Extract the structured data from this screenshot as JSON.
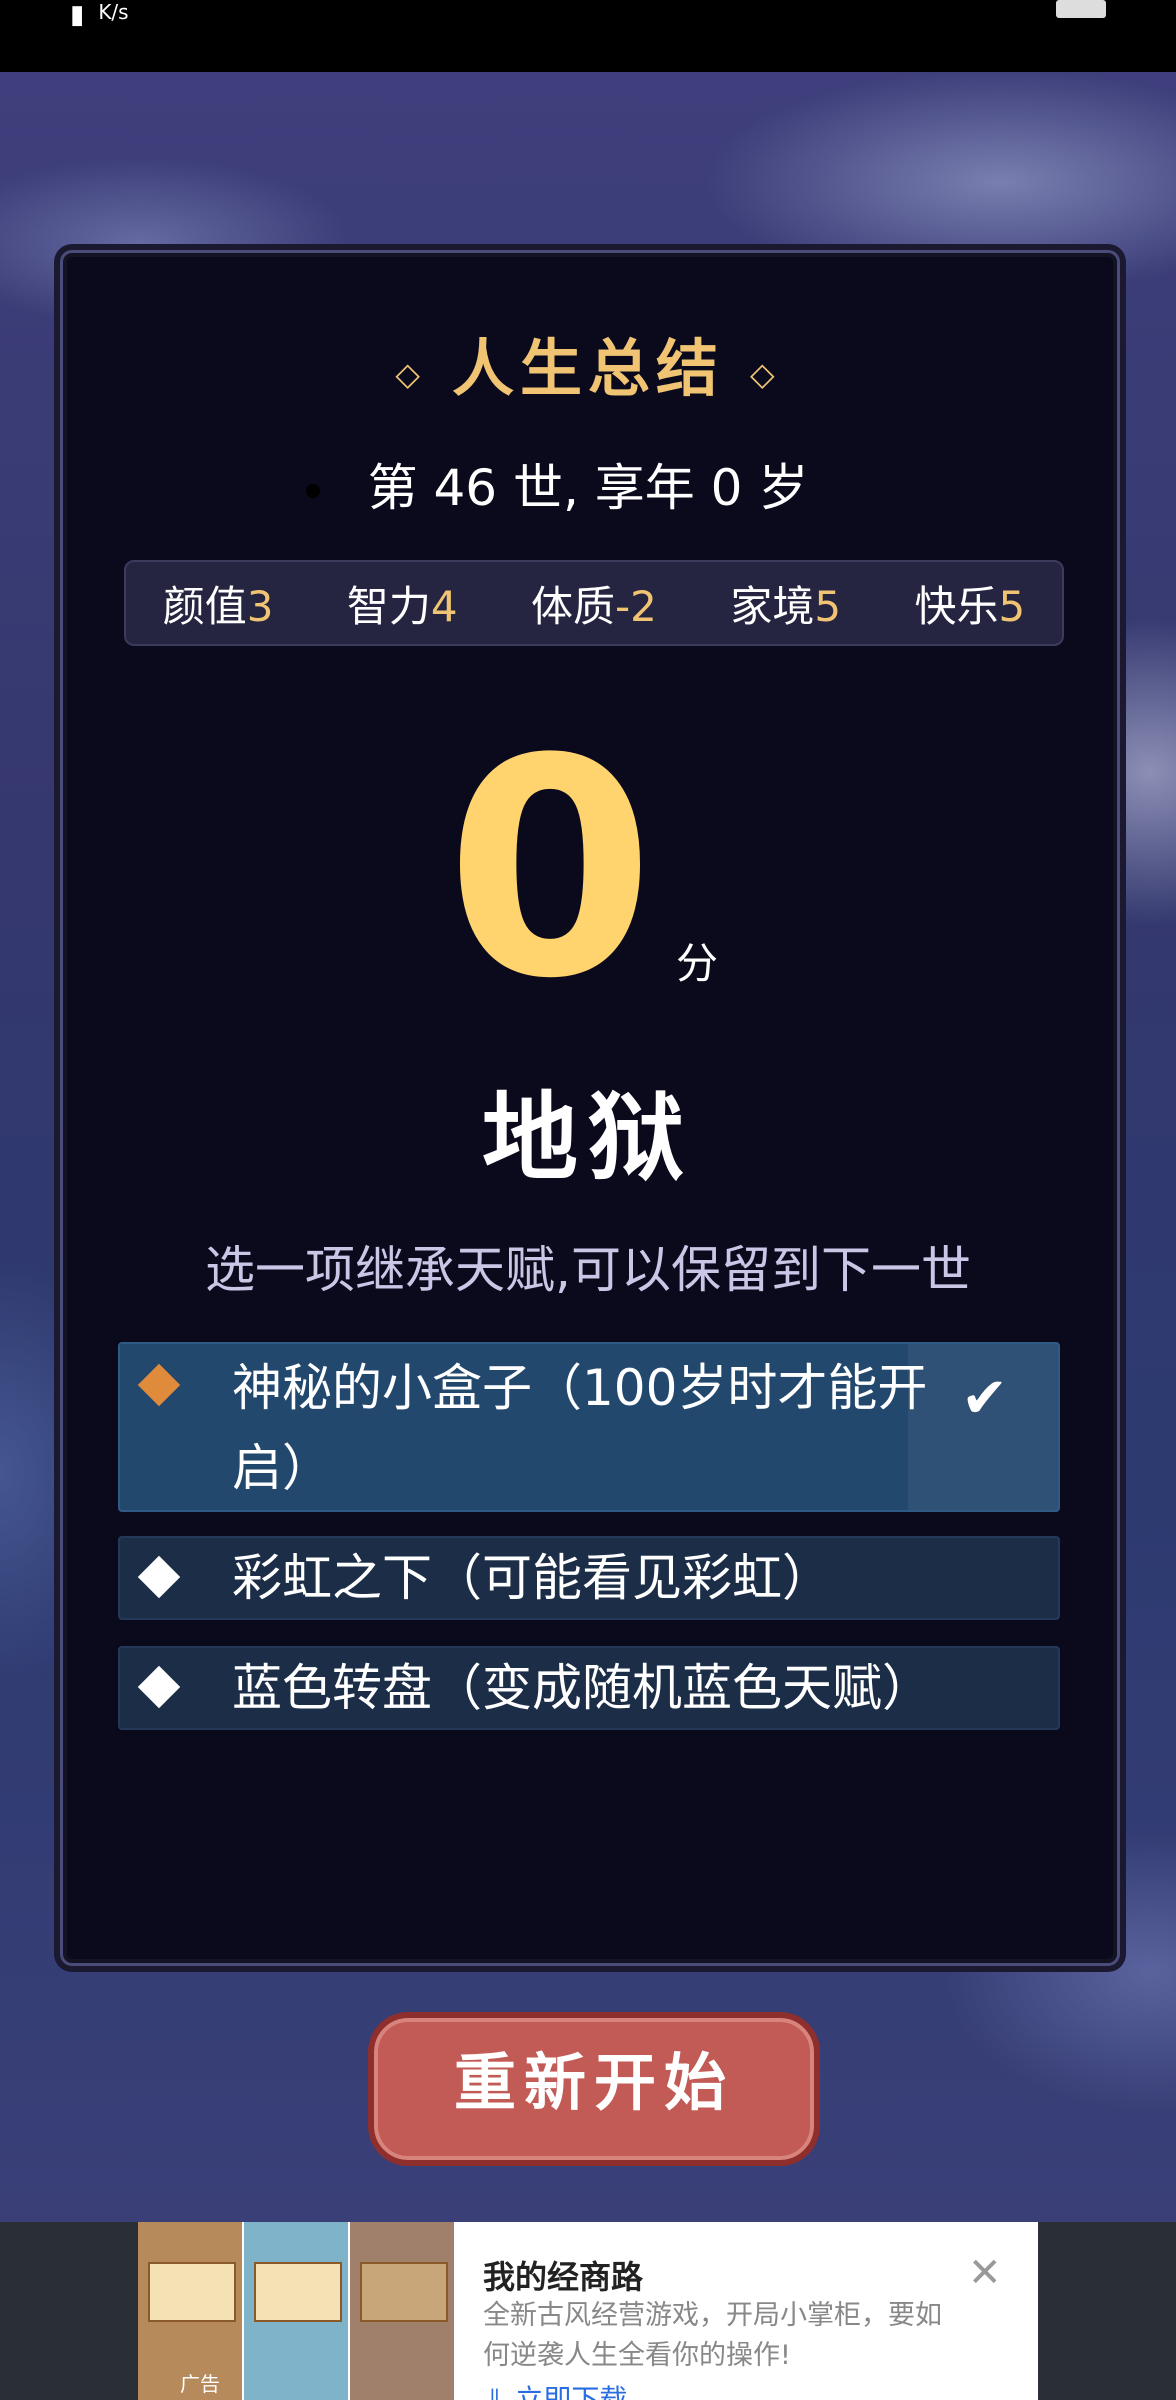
{
  "status_bar": {
    "kbs": "K/s"
  },
  "summary": {
    "title": "人生总结",
    "title_ornament": "◇",
    "life_line": "第 46 世, 享年 0 岁"
  },
  "attributes": [
    {
      "label": "颜值",
      "value": "3"
    },
    {
      "label": "智力",
      "value": "4"
    },
    {
      "label": "体质",
      "value": "-2"
    },
    {
      "label": "家境",
      "value": "5"
    },
    {
      "label": "快乐",
      "value": "5"
    }
  ],
  "score": {
    "value": "0",
    "unit": "分",
    "grade": "地狱"
  },
  "inherit": {
    "prompt": "选一项继承天赋,可以保留到下一世",
    "options": [
      {
        "text": "神秘的小盒子（100岁时才能开启）",
        "selected": true
      },
      {
        "text": "彩虹之下（可能看见彩虹）",
        "selected": false
      },
      {
        "text": "蓝色转盘（变成随机蓝色天赋）",
        "selected": false
      }
    ],
    "check_icon": "✔"
  },
  "restart_button": "重新开始",
  "ad": {
    "label": "广告",
    "title": "我的经商路",
    "description": "全新古风经营游戏，开局小掌柜，要如何逆袭人生全看你的操作!",
    "cta": "⇓ 立即下载",
    "close": "✕"
  }
}
